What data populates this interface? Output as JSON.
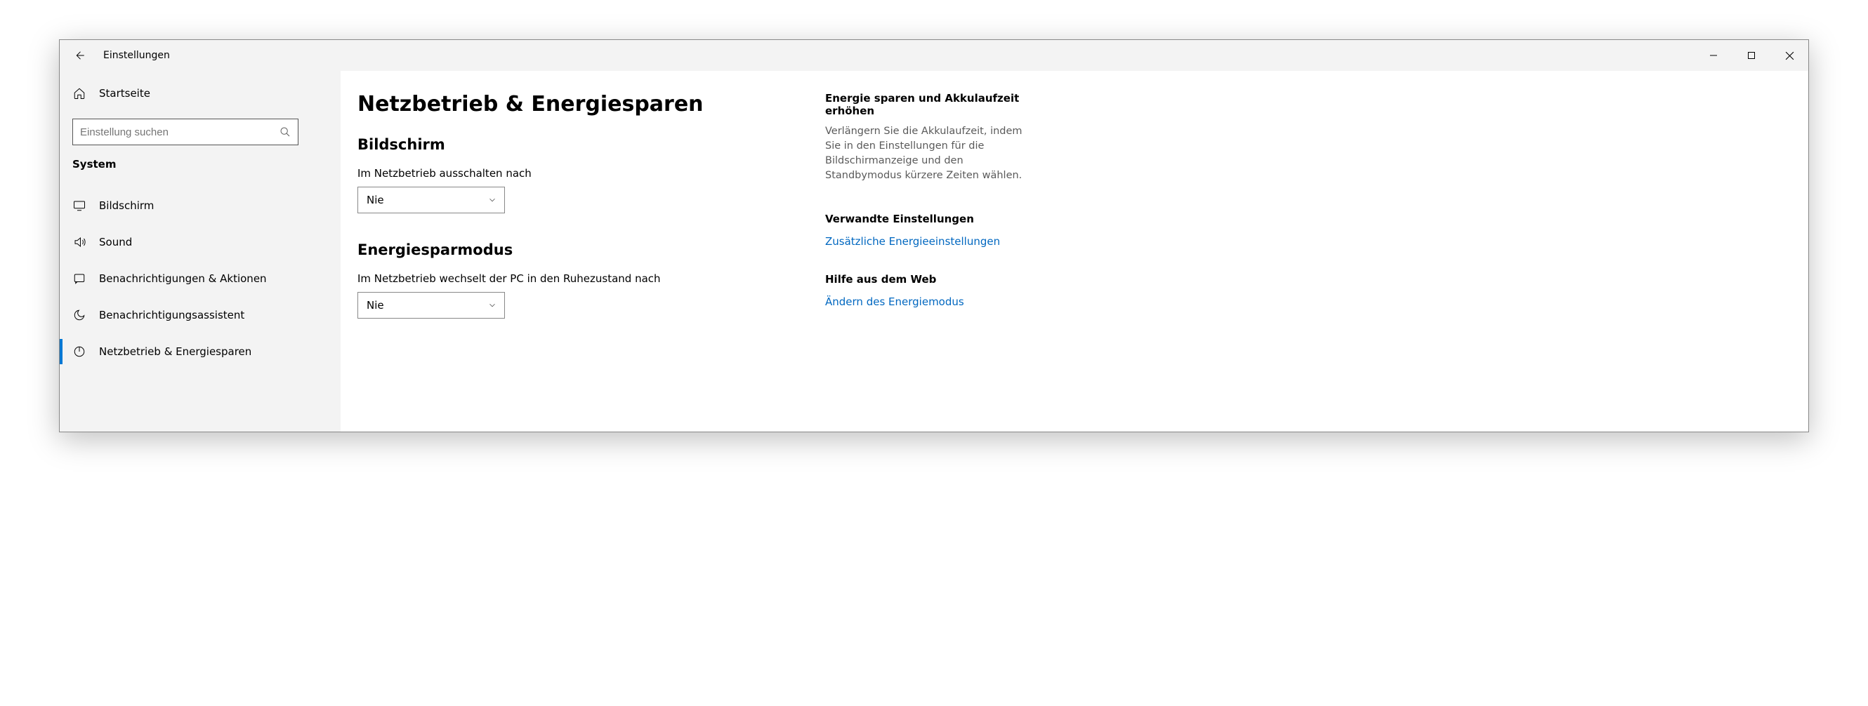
{
  "window": {
    "title": "Einstellungen"
  },
  "sidebar": {
    "home": "Startseite",
    "search_placeholder": "Einstellung suchen",
    "category": "System",
    "items": [
      {
        "icon": "monitor",
        "label": "Bildschirm",
        "active": false
      },
      {
        "icon": "sound",
        "label": "Sound",
        "active": false
      },
      {
        "icon": "notify",
        "label": "Benachrichtigungen & Aktionen",
        "active": false
      },
      {
        "icon": "moon",
        "label": "Benachrichtigungsassistent",
        "active": false
      },
      {
        "icon": "power",
        "label": "Netzbetrieb & Energiesparen",
        "active": true
      }
    ]
  },
  "main": {
    "title": "Netzbetrieb & Energiesparen",
    "section1_title": "Bildschirm",
    "section1_label": "Im Netzbetrieb ausschalten nach",
    "section1_value": "Nie",
    "section2_title": "Energiesparmodus",
    "section2_label": "Im Netzbetrieb wechselt der PC in den Ruhezustand nach",
    "section2_value": "Nie"
  },
  "aside": {
    "tip_title": "Energie sparen und Akkulaufzeit erhöhen",
    "tip_text": "Verlängern Sie die Akkulaufzeit, indem Sie in den Einstellungen für die Bildschirmanzeige und den Standbymodus kürzere Zeiten wählen.",
    "related_title": "Verwandte Einstellungen",
    "related_link": "Zusätzliche Energieeinstellungen",
    "help_title": "Hilfe aus dem Web",
    "help_link": "Ändern des Energiemodus"
  }
}
